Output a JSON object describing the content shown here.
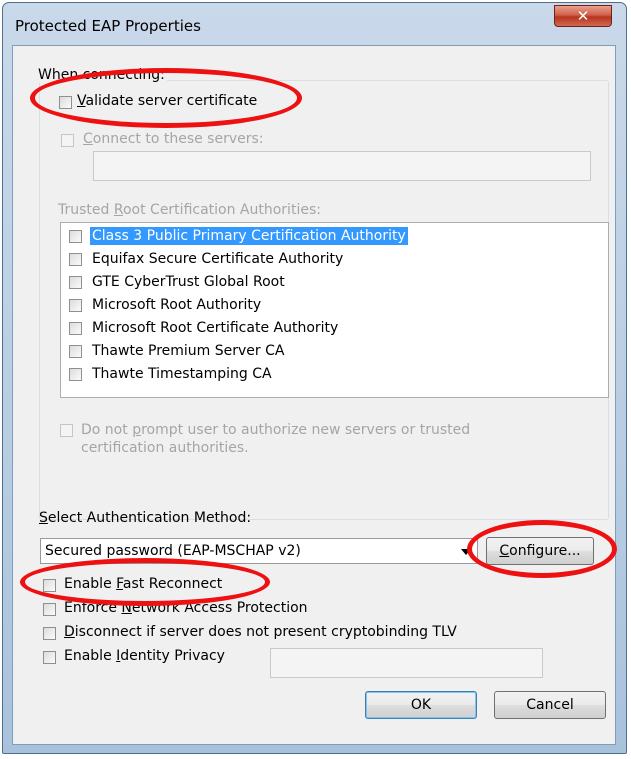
{
  "window": {
    "title": "Protected EAP Properties",
    "close_glyph": "✕"
  },
  "when_connecting": {
    "legend": "When connecting:",
    "validate_cert": {
      "pre": "",
      "mnemonic": "V",
      "post": "alidate server certificate"
    },
    "connect_servers": {
      "pre": "",
      "mnemonic": "C",
      "post": "onnect to these servers:"
    },
    "servers_value": "",
    "trusted_root": {
      "pre": "Trusted ",
      "mnemonic": "R",
      "post": "oot Certification Authorities:"
    },
    "authorities": [
      "Class 3 Public Primary Certification Authority",
      "Equifax Secure Certificate Authority",
      "GTE CyberTrust Global Root",
      "Microsoft Root Authority",
      "Microsoft Root Certificate Authority",
      "Thawte Premium Server CA",
      "Thawte Timestamping CA"
    ],
    "do_not_prompt_line1": {
      "pre": "Do not ",
      "mnemonic": "p",
      "post": "rompt user to authorize new servers or trusted"
    },
    "do_not_prompt_line2": "certification authorities."
  },
  "auth": {
    "label": {
      "pre": "",
      "mnemonic": "S",
      "post": "elect Authentication Method:"
    },
    "method": "Secured password (EAP-MSCHAP v2)",
    "configure": {
      "pre": "",
      "mnemonic": "C",
      "post": "onfigure..."
    }
  },
  "options": {
    "fast_reconnect": {
      "pre": "Enable ",
      "mnemonic": "F",
      "post": "ast Reconnect"
    },
    "nap": {
      "pre": "Enforce ",
      "mnemonic": "N",
      "post": "etwork Access Protection"
    },
    "cryptobinding": {
      "pre": "",
      "mnemonic": "D",
      "post": "isconnect if server does not present cryptobinding TLV"
    },
    "identity_privacy": {
      "pre": "Enable ",
      "mnemonic": "I",
      "post": "dentity Privacy"
    },
    "identity_value": ""
  },
  "buttons": {
    "ok": "OK",
    "cancel": "Cancel"
  },
  "colors": {
    "highlight_ring": "#ee1111",
    "selection": "#3399ff"
  }
}
